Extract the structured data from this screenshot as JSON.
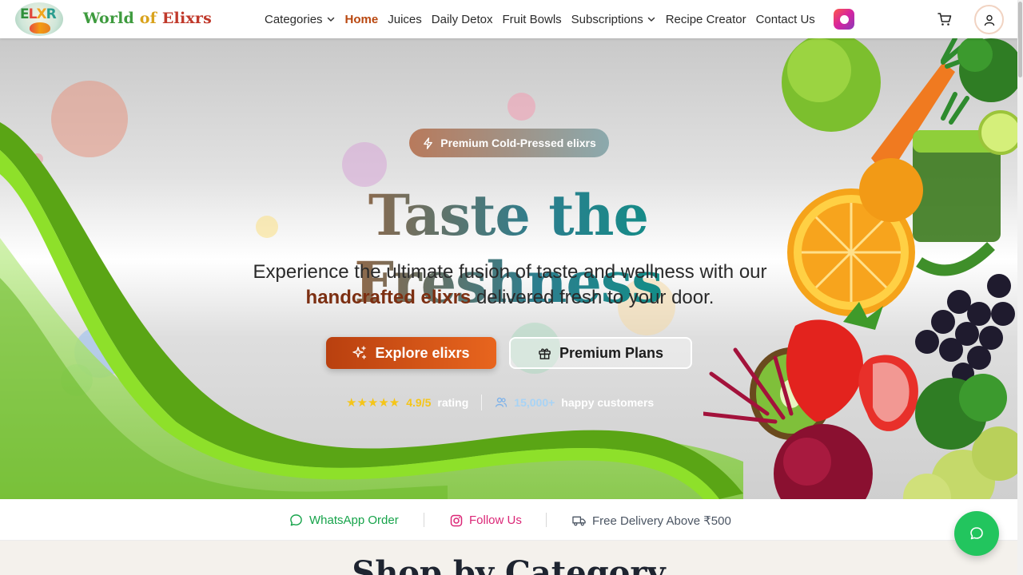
{
  "brand": {
    "logo_text": "ELXR",
    "name_part1": "World ",
    "name_part2": "of ",
    "name_part3": "Elixrs"
  },
  "nav": {
    "items": [
      {
        "label": "Categories",
        "dropdown": true,
        "active": false
      },
      {
        "label": "Home",
        "dropdown": false,
        "active": true
      },
      {
        "label": "Juices",
        "dropdown": false,
        "active": false
      },
      {
        "label": "Daily Detox",
        "dropdown": false,
        "active": false
      },
      {
        "label": "Fruit Bowls",
        "dropdown": false,
        "active": false
      },
      {
        "label": "Subscriptions",
        "dropdown": true,
        "active": false
      },
      {
        "label": "Recipe Creator",
        "dropdown": false,
        "active": false
      },
      {
        "label": "Contact Us",
        "dropdown": false,
        "active": false
      }
    ],
    "icons": {
      "instagram": "instagram-icon",
      "cart": "cart-icon",
      "user": "user-icon"
    }
  },
  "hero": {
    "badge": "Premium Cold-Pressed elixrs",
    "headline": "Taste the Freshness",
    "sub_line1": "Experience the ultimate fusion of taste and wellness with our",
    "sub_highlight": "handcrafted elixrs",
    "sub_line2_rest": " delivered fresh to your door.",
    "cta_primary": "Explore elixrs",
    "cta_secondary": "Premium Plans",
    "stars": "★★★★★",
    "rating_value": "4.9/5",
    "rating_label": "rating",
    "customers_value": "15,000+",
    "customers_label": "happy customers"
  },
  "strip": {
    "whatsapp": "WhatsApp Order",
    "follow": "Follow Us",
    "delivery": "Free Delivery Above ₹500"
  },
  "section": {
    "title": "Shop by Category"
  },
  "colors": {
    "accent": "#b9470f",
    "whatsapp": "#16a34a",
    "instagram": "#db2777",
    "delivery_text": "#4b5563",
    "chat_fab": "#22c55e"
  }
}
